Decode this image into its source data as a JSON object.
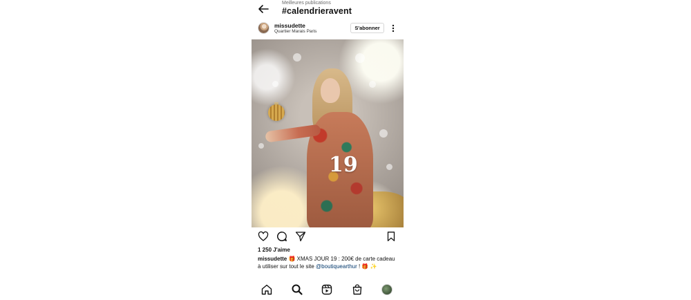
{
  "header": {
    "subtitle": "Meilleures publications",
    "title": "#calendrieravent"
  },
  "post": {
    "username": "missudette",
    "location": "Quartier Marais Paris",
    "follow_label": "S'abonner",
    "photo_number": "19",
    "likes": "1 250 J'aime",
    "caption_user": "missudette",
    "caption_text": " 🎁 XMAS JOUR 19 : 200€ de carte cadeau à utiliser sur tout le site ",
    "caption_mention": "@boutiquearthur",
    "caption_end": " ! 🎁 ✨"
  },
  "actions": [
    "heart-icon",
    "comment-icon",
    "share-icon",
    "bookmark-icon"
  ],
  "bottom_nav": [
    "home-icon",
    "search-icon",
    "reels-icon",
    "shop-icon",
    "profile-avatar"
  ]
}
